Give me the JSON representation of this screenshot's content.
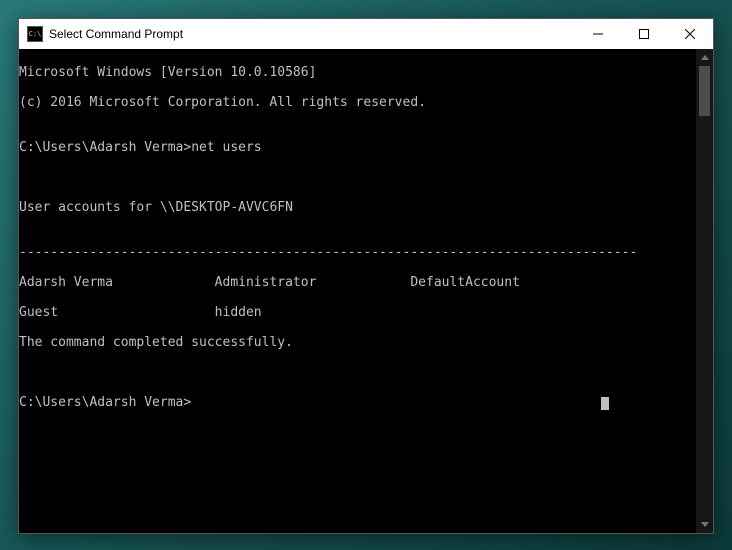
{
  "window": {
    "title": "Select Command Prompt"
  },
  "terminal": {
    "line1": "Microsoft Windows [Version 10.0.10586]",
    "line2": "(c) 2016 Microsoft Corporation. All rights reserved.",
    "blank1": "",
    "prompt1_path": "C:\\Users\\Adarsh Verma>",
    "prompt1_cmd": "net users",
    "blank2": "",
    "blank3": "",
    "accounts_header": "User accounts for \\\\DESKTOP-AVVC6FN",
    "blank4": "",
    "divider": "-------------------------------------------------------------------------------",
    "users_row1": "Adarsh Verma             Administrator            DefaultAccount",
    "users_row2": "Guest                    hidden",
    "completed": "The command completed successfully.",
    "blank5": "",
    "blank6": "",
    "prompt2_path": "C:\\Users\\Adarsh Verma>"
  },
  "icons": {
    "app_icon_text": "C:\\"
  }
}
